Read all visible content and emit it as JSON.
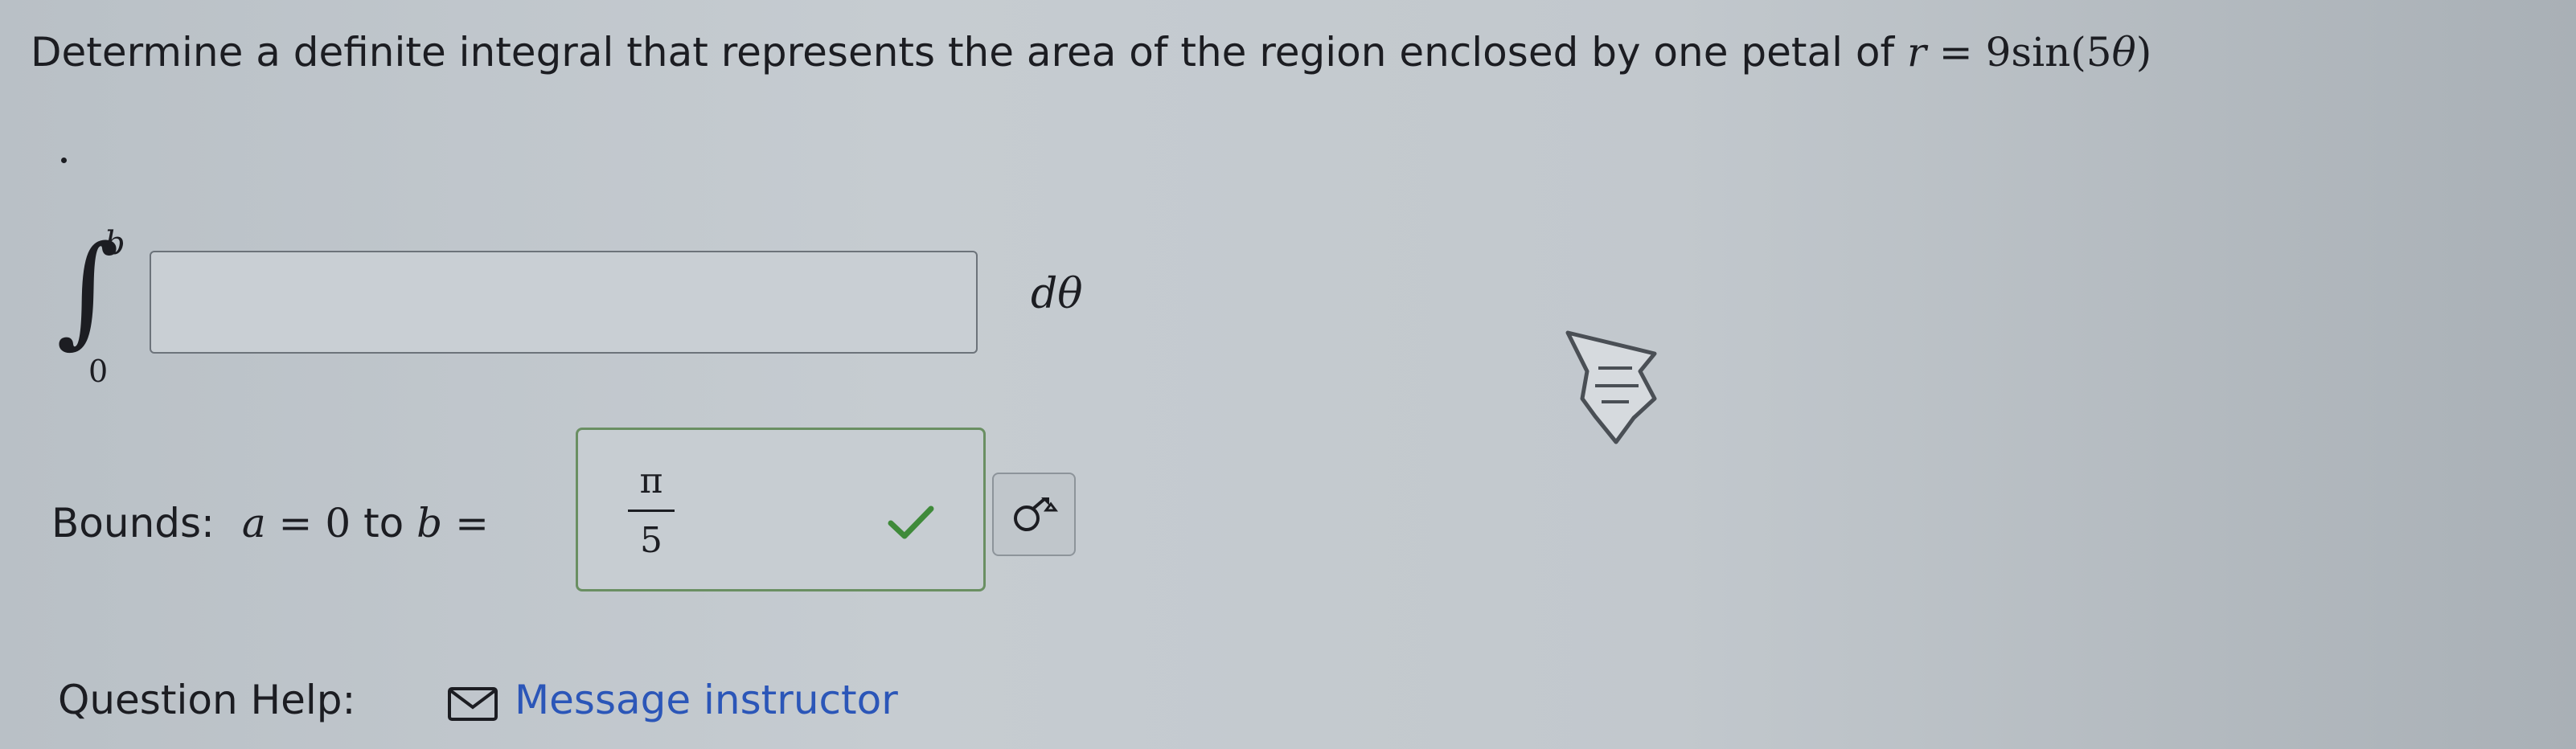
{
  "question": {
    "prefix": "Determine a definite integral that represents the area of the region enclosed by one petal of ",
    "r_var": "r",
    "equals": "=",
    "coef": "9",
    "func": "sin",
    "paren_open": "(",
    "arg_num": "5",
    "arg_var": "θ",
    "paren_close": ")",
    "period": "."
  },
  "integral": {
    "symbol": "∫",
    "upper": "b",
    "lower": "0",
    "integrand_value": "",
    "differential": "dθ"
  },
  "bounds": {
    "label": "Bounds:",
    "a_var": "a",
    "equals": "=",
    "a_val": "0",
    "to": "to",
    "b_var": "b",
    "b_equals": "=",
    "b_numerator": "π",
    "b_denominator": "5"
  },
  "help": {
    "label": "Question Help:",
    "link": "Message instructor"
  },
  "colors": {
    "correct_check": "#3f8a3a",
    "link": "#2b56b8"
  },
  "icons": {
    "status": "checkmark-icon",
    "keyboard": "math-key-icon",
    "mail": "envelope-icon",
    "pointer": "hand-cursor-icon"
  }
}
